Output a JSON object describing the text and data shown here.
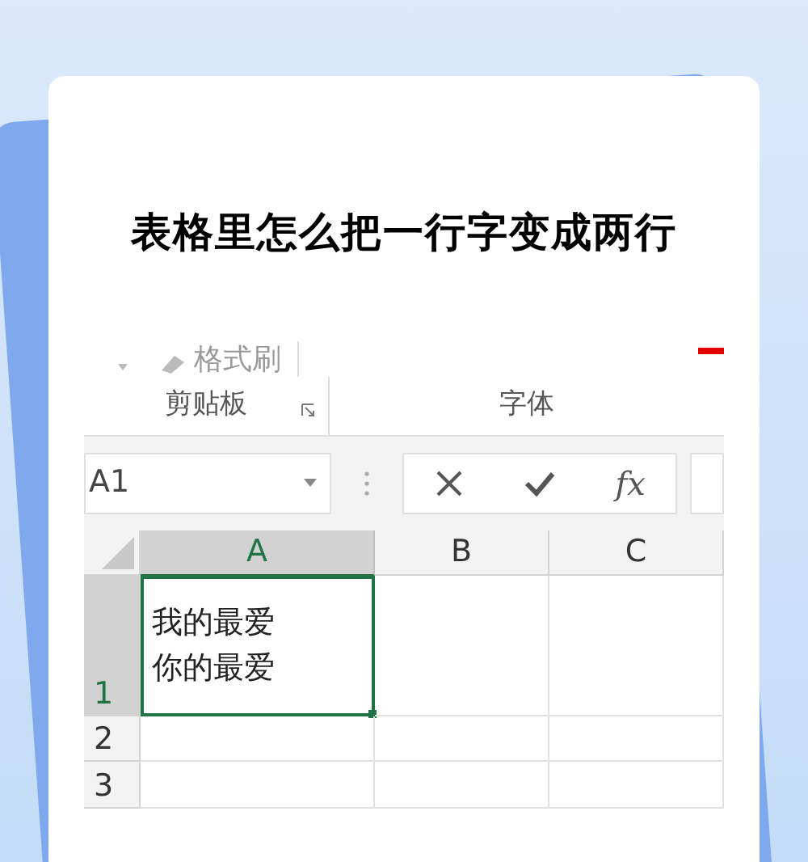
{
  "title": "表格里怎么把一行字变成两行",
  "ribbon": {
    "format_painter": "格式刷",
    "groups": [
      {
        "label": "剪贴板",
        "launcher": true
      },
      {
        "label": "字体",
        "launcher": false
      }
    ]
  },
  "name_box": {
    "value": "A1"
  },
  "formula_buttons": [
    {
      "kind": "cancel"
    },
    {
      "kind": "enter"
    },
    {
      "kind": "function",
      "label": "fx"
    }
  ],
  "columns": [
    {
      "label": "A",
      "selected": true
    },
    {
      "label": "B",
      "selected": false
    },
    {
      "label": "C",
      "selected": false
    }
  ],
  "rows": [
    {
      "header": "1",
      "selected": true,
      "cells": [
        {
          "lines": [
            "我的最爱",
            "你的最爱"
          ],
          "active": true
        },
        {
          "active": false
        },
        {
          "active": false
        }
      ]
    },
    {
      "header": "2",
      "selected": false,
      "cells": [
        {
          "active": false
        },
        {
          "active": false
        },
        {
          "active": false
        }
      ]
    },
    {
      "header": "3",
      "selected": false,
      "cells": [
        {
          "active": false
        },
        {
          "active": false
        },
        {
          "active": false
        }
      ]
    }
  ]
}
